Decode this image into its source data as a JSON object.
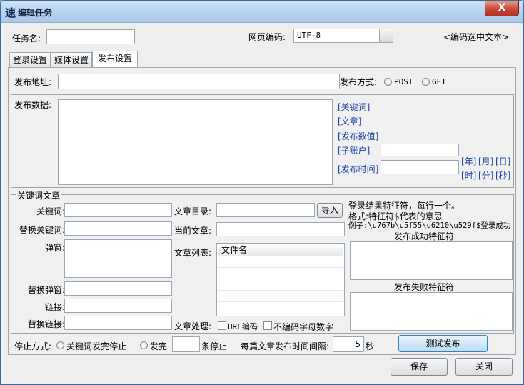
{
  "window": {
    "title": "编辑任务",
    "app_icon": "速",
    "close_label": "X"
  },
  "top": {
    "task_name_label": "任务名:",
    "task_name_value": "",
    "encoding_label": "网页编码:",
    "encoding_value": "UTF-8",
    "encoding_hint": "<编码选中文本>"
  },
  "tabs": [
    {
      "label": "登录设置"
    },
    {
      "label": "媒体设置"
    },
    {
      "label": "发布设置"
    }
  ],
  "publish": {
    "address_label": "发布地址:",
    "address_value": "",
    "method_label": "发布方式:",
    "method_options": [
      "POST",
      "GET"
    ],
    "data_label": "发布数据:",
    "data_value": "",
    "tags": [
      "[关键词]",
      "[文章]",
      "[发布数值]"
    ],
    "sub_account_label": "[子账户]",
    "publish_time_label": "[发布时间]",
    "date_tags": [
      "[年]",
      "[月]",
      "[日]"
    ],
    "time_tags": [
      "[时]",
      "[分]",
      "[秒]"
    ]
  },
  "keyword_group": {
    "legend": "关键词文章",
    "keyword_label": "关键词:",
    "replace_keyword_label": "替换关键词:",
    "popup_label": "弹窗:",
    "replace_popup_label": "替换弹窗:",
    "link_label": "链接:",
    "replace_link_label": "替换链接:",
    "article_dir_label": "文章目录:",
    "import_label": "导入",
    "current_article_label": "当前文章:",
    "article_list_label": "文章列表:",
    "list_header": "文件名",
    "process_label": "文章处理:",
    "url_encode_label": "URL编码",
    "no_encode_label": "不编码字母数字",
    "hint_line1": "登录结果特征符，每行一个。",
    "hint_line2": "格式:特征符$代表的意思",
    "hint_line3": "例子:\\u767b\\u5f55\\u6210\\u529f$登录成功",
    "success_label": "发布成功特征符",
    "fail_label": "发布失败特征符"
  },
  "bottom": {
    "stop_label": "停止方式:",
    "stop_opt1": "关键词发完停止",
    "stop_opt2": "发完",
    "stop_count_value": "",
    "stop_suffix": "条停止",
    "interval_label": "每篇文章发布时间间隔:",
    "interval_value": "5",
    "interval_unit": "秒",
    "test_label": "测试发布",
    "save_label": "保存",
    "close_label": "关闭"
  }
}
